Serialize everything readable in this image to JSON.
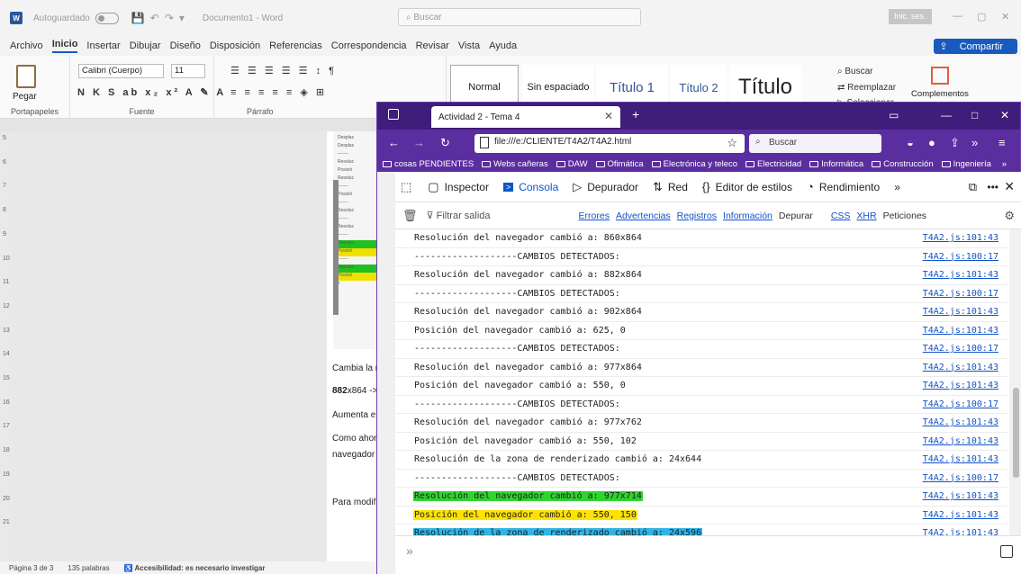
{
  "word": {
    "autosave_label": "Autoguardado",
    "doc_title": "Documento1 - Word",
    "search_placeholder": "Buscar",
    "sign_in": "Inic. ses.",
    "menu": [
      "Archivo",
      "Inicio",
      "Insertar",
      "Dibujar",
      "Diseño",
      "Disposición",
      "Referencias",
      "Correspondencia",
      "Revisar",
      "Vista",
      "Ayuda"
    ],
    "share": "Compartir",
    "paste": "Pegar",
    "font_name": "Calibri (Cuerpo)",
    "font_size": "11",
    "group_clipboard": "Portapapeles",
    "group_font": "Fuente",
    "group_paragraph": "Párrafo",
    "styles": {
      "normal": "Normal",
      "sin": "Sin espaciado",
      "t1": "Título 1",
      "t2": "Título 2",
      "t": "Título"
    },
    "edit": {
      "find": "Buscar",
      "replace": "Reemplazar",
      "select": "Seleccionar"
    },
    "addins": "Complementos",
    "ruler_numbers": [
      "5",
      "6",
      "7",
      "8",
      "9",
      "10",
      "11",
      "12",
      "13",
      "14",
      "15",
      "16",
      "17",
      "18",
      "19",
      "20",
      "21"
    ],
    "embedded_lines": [
      {
        "t": "Desplaz",
        "c": ""
      },
      {
        "t": "Desplaz",
        "c": ""
      },
      {
        "t": "-------",
        "c": ""
      },
      {
        "t": "Resoluc",
        "c": ""
      },
      {
        "t": "Posició",
        "c": ""
      },
      {
        "t": "Resoluc",
        "c": ""
      },
      {
        "t": "-------",
        "c": ""
      },
      {
        "t": "Posició",
        "c": ""
      },
      {
        "t": "-------",
        "c": ""
      },
      {
        "t": "Resoluc",
        "c": ""
      },
      {
        "t": "-------",
        "c": ""
      },
      {
        "t": "Resoluc",
        "c": ""
      },
      {
        "t": "-------",
        "c": ""
      },
      {
        "t": "Resoluc",
        "c": "g"
      },
      {
        "t": "Posició",
        "c": "y"
      },
      {
        "t": "-------",
        "c": ""
      },
      {
        "t": "Resoluc",
        "c": "g"
      },
      {
        "t": "Posició",
        "c": "y"
      },
      {
        "t": "»",
        "c": ""
      }
    ],
    "body_text": {
      "p1": "Cambia la r",
      "p2a": "882",
      "p2b": "x864 ->",
      "p3": "Aumenta el",
      "p4": "Como ahor",
      "p5": "navegador",
      "p6": "Para modifi"
    },
    "status": {
      "page": "Página 3 de 3",
      "words": "135 palabras",
      "access": "Accesibilidad: es necesario investigar"
    }
  },
  "firefox": {
    "tab_title": "Actividad 2 - Tema 4",
    "url": "file:///e:/CLIENTE/T4A2/T4A2.html",
    "search_placeholder": "Buscar",
    "bookmarks": [
      "cosas PENDIENTES",
      "Webs cañeras",
      "DAW",
      "Ofimática",
      "Electrónica y teleco",
      "Electricidad",
      "Informática",
      "Construcción",
      "Ingeniería"
    ],
    "devtools_tabs": [
      "Inspector",
      "Consola",
      "Depurador",
      "Red",
      "Editor de estilos",
      "Rendimiento"
    ],
    "filter_placeholder": "Filtrar salida",
    "filters": {
      "errors": "Errores",
      "warnings": "Advertencias",
      "logs": "Registros",
      "info": "Información",
      "debug": "Depurar",
      "css": "CSS",
      "xhr": "XHR",
      "requests": "Peticiones"
    },
    "console_rows": [
      {
        "msg": "Resolución del navegador cambió a: 860x864",
        "src": "T4A2.js:101:43",
        "hl": ""
      },
      {
        "msg": "-------------------CAMBIOS DETECTADOS:",
        "src": "T4A2.js:100:17",
        "hl": ""
      },
      {
        "msg": "Resolución del navegador cambió a: 882x864",
        "src": "T4A2.js:101:43",
        "hl": ""
      },
      {
        "msg": "-------------------CAMBIOS DETECTADOS:",
        "src": "T4A2.js:100:17",
        "hl": ""
      },
      {
        "msg": "Resolución del navegador cambió a: 902x864",
        "src": "T4A2.js:101:43",
        "hl": ""
      },
      {
        "msg": "Posición del navegador cambió a: 625, 0",
        "src": "T4A2.js:101:43",
        "hl": ""
      },
      {
        "msg": "-------------------CAMBIOS DETECTADOS:",
        "src": "T4A2.js:100:17",
        "hl": ""
      },
      {
        "msg": "Resolución del navegador cambió a: 977x864",
        "src": "T4A2.js:101:43",
        "hl": ""
      },
      {
        "msg": "Posición del navegador cambió a: 550, 0",
        "src": "T4A2.js:101:43",
        "hl": ""
      },
      {
        "msg": "-------------------CAMBIOS DETECTADOS:",
        "src": "T4A2.js:100:17",
        "hl": ""
      },
      {
        "msg": "Resolución del navegador cambió a: 977x762",
        "src": "T4A2.js:101:43",
        "hl": ""
      },
      {
        "msg": "Posición del navegador cambió a: 550, 102",
        "src": "T4A2.js:101:43",
        "hl": ""
      },
      {
        "msg": "Resolución de la zona de renderizado cambió a: 24x644",
        "src": "T4A2.js:101:43",
        "hl": ""
      },
      {
        "msg": "-------------------CAMBIOS DETECTADOS:",
        "src": "T4A2.js:100:17",
        "hl": ""
      },
      {
        "msg": "Resolución del navegador cambió a: 977x714",
        "src": "T4A2.js:101:43",
        "hl": "g"
      },
      {
        "msg": "Posición del navegador cambió a: 550, 150",
        "src": "T4A2.js:101:43",
        "hl": "y"
      },
      {
        "msg": "Resolución de la zona de renderizado cambió a: 24x596",
        "src": "T4A2.js:101:43",
        "hl": "b"
      }
    ],
    "prompt": "»",
    "colors": {
      "tabbar": "#3f1d7a",
      "toolbar": "#5b2ea0",
      "link": "#1252c9",
      "active_tab": "#0a58c8"
    }
  }
}
